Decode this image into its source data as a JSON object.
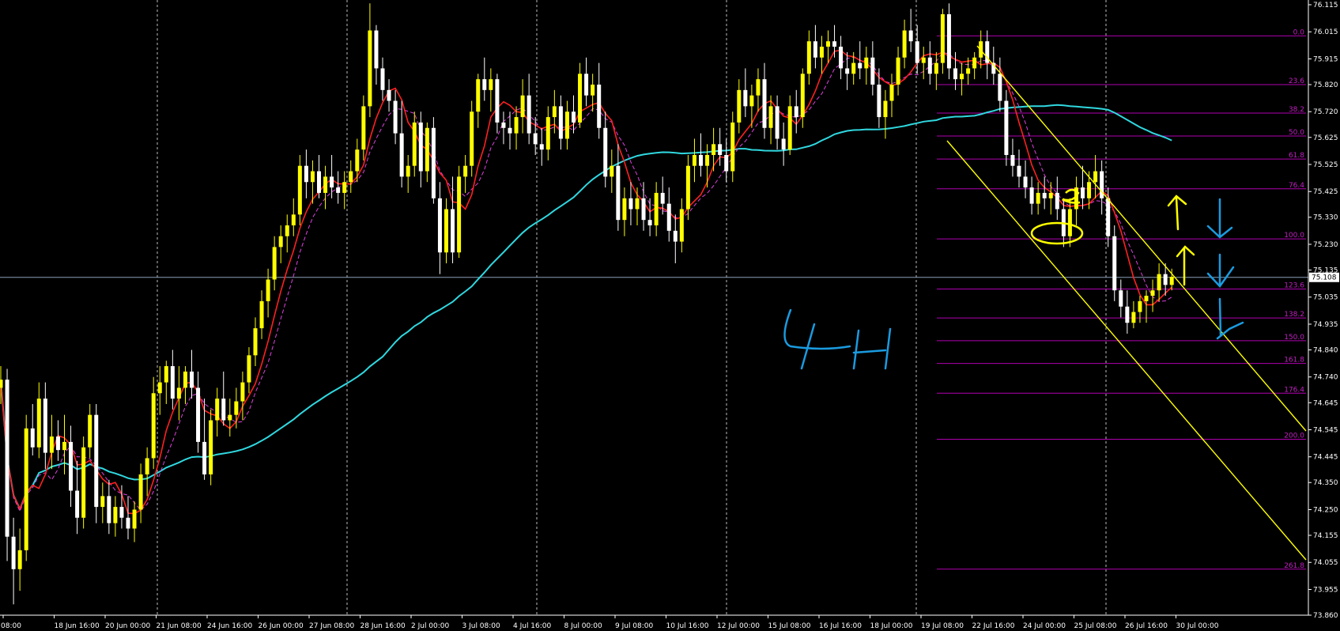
{
  "chart_data": {
    "type": "candlestick",
    "timeframe_annotation": "4H",
    "ylim": [
      73.86,
      76.115
    ],
    "price_axis_labels": [
      "76.115",
      "76.015",
      "75.915",
      "75.820",
      "75.720",
      "75.625",
      "75.525",
      "75.425",
      "75.330",
      "75.230",
      "75.135",
      "75.035",
      "74.935",
      "74.840",
      "74.740",
      "74.645",
      "74.545",
      "74.445",
      "74.350",
      "74.250",
      "74.155",
      "74.055",
      "73.955",
      "73.860"
    ],
    "time_axis_labels": [
      "08:00",
      "18 Jun 16:00",
      "20 Jun 00:00",
      "21 Jun 08:00",
      "24 Jun 16:00",
      "26 Jun 00:00",
      "27 Jun 08:00",
      "28 Jun 16:00",
      "2 Jul 00:00",
      "3 Jul 08:00",
      "4 Jul 16:00",
      "8 Jul 00:00",
      "9 Jul 08:00",
      "10 Jul 16:00",
      "12 Jul 00:00",
      "15 Jul 08:00",
      "16 Jul 16:00",
      "18 Jul 00:00",
      "19 Jul 08:00",
      "22 Jul 16:00",
      "24 Jul 00:00",
      "25 Jul 08:00",
      "26 Jul 16:00",
      "30 Jul 00:00"
    ],
    "current_price": "75.108",
    "fibonacci_levels": [
      {
        "label": "0.0",
        "price": 76.0
      },
      {
        "label": "23.6",
        "price": 75.82
      },
      {
        "label": "38.2",
        "price": 75.715
      },
      {
        "label": "50.0",
        "price": 75.63
      },
      {
        "label": "61.8",
        "price": 75.545
      },
      {
        "label": "76.4",
        "price": 75.435
      },
      {
        "label": "100.0",
        "price": 75.25
      },
      {
        "label": "123.6",
        "price": 75.065
      },
      {
        "label": "138.2",
        "price": 74.958
      },
      {
        "label": "150.0",
        "price": 74.874
      },
      {
        "label": "161.8",
        "price": 74.79
      },
      {
        "label": "176.4",
        "price": 74.68
      },
      {
        "label": "200.0",
        "price": 74.51
      },
      {
        "label": "261.8",
        "price": 74.03
      }
    ],
    "candles": [
      {
        "o": 74.7,
        "h": 74.78,
        "l": 74.64,
        "c": 74.73
      },
      {
        "o": 74.73,
        "h": 74.77,
        "l": 74.06,
        "c": 74.15
      },
      {
        "o": 74.15,
        "h": 74.22,
        "l": 73.9,
        "c": 74.03
      },
      {
        "o": 74.03,
        "h": 74.18,
        "l": 73.95,
        "c": 74.1
      },
      {
        "o": 74.1,
        "h": 74.6,
        "l": 74.06,
        "c": 74.55
      },
      {
        "o": 74.55,
        "h": 74.64,
        "l": 74.45,
        "c": 74.48
      },
      {
        "o": 74.48,
        "h": 74.72,
        "l": 74.44,
        "c": 74.66
      },
      {
        "o": 74.66,
        "h": 74.72,
        "l": 74.4,
        "c": 74.46
      },
      {
        "o": 74.46,
        "h": 74.6,
        "l": 74.4,
        "c": 74.52
      },
      {
        "o": 74.52,
        "h": 74.58,
        "l": 74.43,
        "c": 74.47
      },
      {
        "o": 74.47,
        "h": 74.6,
        "l": 74.38,
        "c": 74.5
      },
      {
        "o": 74.5,
        "h": 74.56,
        "l": 74.26,
        "c": 74.32
      },
      {
        "o": 74.32,
        "h": 74.43,
        "l": 74.16,
        "c": 74.22
      },
      {
        "o": 74.22,
        "h": 74.52,
        "l": 74.18,
        "c": 74.48
      },
      {
        "o": 74.48,
        "h": 74.64,
        "l": 74.44,
        "c": 74.6
      },
      {
        "o": 74.6,
        "h": 74.64,
        "l": 74.2,
        "c": 74.26
      },
      {
        "o": 74.26,
        "h": 74.35,
        "l": 74.2,
        "c": 74.3
      },
      {
        "o": 74.3,
        "h": 74.36,
        "l": 74.16,
        "c": 74.2
      },
      {
        "o": 74.2,
        "h": 74.3,
        "l": 74.15,
        "c": 74.26
      },
      {
        "o": 74.26,
        "h": 74.34,
        "l": 74.18,
        "c": 74.22
      },
      {
        "o": 74.22,
        "h": 74.3,
        "l": 74.14,
        "c": 74.18
      },
      {
        "o": 74.18,
        "h": 74.28,
        "l": 74.13,
        "c": 74.25
      },
      {
        "o": 74.25,
        "h": 74.42,
        "l": 74.2,
        "c": 74.38
      },
      {
        "o": 74.38,
        "h": 74.48,
        "l": 74.3,
        "c": 74.44
      },
      {
        "o": 74.44,
        "h": 74.74,
        "l": 74.4,
        "c": 74.68
      },
      {
        "o": 74.68,
        "h": 74.78,
        "l": 74.6,
        "c": 74.72
      },
      {
        "o": 74.72,
        "h": 74.8,
        "l": 74.64,
        "c": 74.78
      },
      {
        "o": 74.78,
        "h": 74.84,
        "l": 74.62,
        "c": 74.66
      },
      {
        "o": 74.66,
        "h": 74.78,
        "l": 74.58,
        "c": 74.7
      },
      {
        "o": 74.7,
        "h": 74.78,
        "l": 74.64,
        "c": 74.76
      },
      {
        "o": 74.76,
        "h": 74.84,
        "l": 74.66,
        "c": 74.7
      },
      {
        "o": 74.7,
        "h": 74.76,
        "l": 74.46,
        "c": 74.5
      },
      {
        "o": 74.5,
        "h": 74.66,
        "l": 74.36,
        "c": 74.38
      },
      {
        "o": 74.38,
        "h": 74.62,
        "l": 74.34,
        "c": 74.58
      },
      {
        "o": 74.58,
        "h": 74.7,
        "l": 74.52,
        "c": 74.66
      },
      {
        "o": 74.66,
        "h": 74.76,
        "l": 74.56,
        "c": 74.58
      },
      {
        "o": 74.58,
        "h": 74.66,
        "l": 74.52,
        "c": 74.6
      },
      {
        "o": 74.6,
        "h": 74.7,
        "l": 74.55,
        "c": 74.65
      },
      {
        "o": 74.65,
        "h": 74.76,
        "l": 74.58,
        "c": 74.72
      },
      {
        "o": 74.72,
        "h": 74.85,
        "l": 74.68,
        "c": 74.82
      },
      {
        "o": 74.82,
        "h": 74.96,
        "l": 74.78,
        "c": 74.92
      },
      {
        "o": 74.92,
        "h": 75.06,
        "l": 74.88,
        "c": 75.02
      },
      {
        "o": 75.02,
        "h": 75.14,
        "l": 74.96,
        "c": 75.1
      },
      {
        "o": 75.1,
        "h": 75.26,
        "l": 75.06,
        "c": 75.22
      },
      {
        "o": 75.22,
        "h": 75.3,
        "l": 75.16,
        "c": 75.26
      },
      {
        "o": 75.26,
        "h": 75.34,
        "l": 75.2,
        "c": 75.3
      },
      {
        "o": 75.3,
        "h": 75.4,
        "l": 75.26,
        "c": 75.34
      },
      {
        "o": 75.34,
        "h": 75.56,
        "l": 75.3,
        "c": 75.52
      },
      {
        "o": 75.52,
        "h": 75.58,
        "l": 75.4,
        "c": 75.46
      },
      {
        "o": 75.46,
        "h": 75.54,
        "l": 75.38,
        "c": 75.5
      },
      {
        "o": 75.5,
        "h": 75.56,
        "l": 75.4,
        "c": 75.42
      },
      {
        "o": 75.42,
        "h": 75.52,
        "l": 75.36,
        "c": 75.48
      },
      {
        "o": 75.48,
        "h": 75.56,
        "l": 75.4,
        "c": 75.44
      },
      {
        "o": 75.44,
        "h": 75.5,
        "l": 75.38,
        "c": 75.42
      },
      {
        "o": 75.42,
        "h": 75.5,
        "l": 75.36,
        "c": 75.46
      },
      {
        "o": 75.46,
        "h": 75.54,
        "l": 75.42,
        "c": 75.5
      },
      {
        "o": 75.5,
        "h": 75.62,
        "l": 75.46,
        "c": 75.58
      },
      {
        "o": 75.58,
        "h": 75.78,
        "l": 75.54,
        "c": 75.74
      },
      {
        "o": 75.74,
        "h": 76.12,
        "l": 75.7,
        "c": 76.02
      },
      {
        "o": 76.02,
        "h": 76.04,
        "l": 75.82,
        "c": 75.88
      },
      {
        "o": 75.88,
        "h": 75.92,
        "l": 75.76,
        "c": 75.8
      },
      {
        "o": 75.8,
        "h": 75.84,
        "l": 75.72,
        "c": 75.76
      },
      {
        "o": 75.76,
        "h": 75.8,
        "l": 75.6,
        "c": 75.64
      },
      {
        "o": 75.64,
        "h": 75.76,
        "l": 75.44,
        "c": 75.48
      },
      {
        "o": 75.48,
        "h": 75.56,
        "l": 75.42,
        "c": 75.52
      },
      {
        "o": 75.52,
        "h": 75.72,
        "l": 75.48,
        "c": 75.68
      },
      {
        "o": 75.68,
        "h": 75.72,
        "l": 75.44,
        "c": 75.5
      },
      {
        "o": 75.5,
        "h": 75.68,
        "l": 75.46,
        "c": 75.66
      },
      {
        "o": 75.66,
        "h": 75.7,
        "l": 75.38,
        "c": 75.4
      },
      {
        "o": 75.4,
        "h": 75.46,
        "l": 75.12,
        "c": 75.2
      },
      {
        "o": 75.2,
        "h": 75.4,
        "l": 75.16,
        "c": 75.36
      },
      {
        "o": 75.36,
        "h": 75.48,
        "l": 75.16,
        "c": 75.2
      },
      {
        "o": 75.2,
        "h": 75.52,
        "l": 75.18,
        "c": 75.48
      },
      {
        "o": 75.48,
        "h": 75.56,
        "l": 75.42,
        "c": 75.52
      },
      {
        "o": 75.52,
        "h": 75.76,
        "l": 75.48,
        "c": 75.72
      },
      {
        "o": 75.72,
        "h": 75.86,
        "l": 75.66,
        "c": 75.84
      },
      {
        "o": 75.84,
        "h": 75.92,
        "l": 75.76,
        "c": 75.8
      },
      {
        "o": 75.8,
        "h": 75.88,
        "l": 75.72,
        "c": 75.84
      },
      {
        "o": 75.84,
        "h": 75.86,
        "l": 75.64,
        "c": 75.68
      },
      {
        "o": 75.68,
        "h": 75.72,
        "l": 75.6,
        "c": 75.66
      },
      {
        "o": 75.66,
        "h": 75.72,
        "l": 75.58,
        "c": 75.64
      },
      {
        "o": 75.64,
        "h": 75.74,
        "l": 75.58,
        "c": 75.7
      },
      {
        "o": 75.7,
        "h": 75.84,
        "l": 75.64,
        "c": 75.78
      },
      {
        "o": 75.78,
        "h": 75.86,
        "l": 75.6,
        "c": 75.64
      },
      {
        "o": 75.64,
        "h": 75.7,
        "l": 75.56,
        "c": 75.6
      },
      {
        "o": 75.6,
        "h": 75.66,
        "l": 75.52,
        "c": 75.58
      },
      {
        "o": 75.58,
        "h": 75.74,
        "l": 75.54,
        "c": 75.7
      },
      {
        "o": 75.7,
        "h": 75.8,
        "l": 75.64,
        "c": 75.74
      },
      {
        "o": 75.74,
        "h": 75.78,
        "l": 75.58,
        "c": 75.62
      },
      {
        "o": 75.62,
        "h": 75.76,
        "l": 75.58,
        "c": 75.72
      },
      {
        "o": 75.72,
        "h": 75.78,
        "l": 75.64,
        "c": 75.68
      },
      {
        "o": 75.68,
        "h": 75.9,
        "l": 75.66,
        "c": 75.86
      },
      {
        "o": 75.86,
        "h": 75.92,
        "l": 75.74,
        "c": 75.78
      },
      {
        "o": 75.78,
        "h": 75.86,
        "l": 75.72,
        "c": 75.82
      },
      {
        "o": 75.82,
        "h": 75.9,
        "l": 75.62,
        "c": 75.66
      },
      {
        "o": 75.66,
        "h": 75.72,
        "l": 75.44,
        "c": 75.48
      },
      {
        "o": 75.48,
        "h": 75.58,
        "l": 75.42,
        "c": 75.52
      },
      {
        "o": 75.52,
        "h": 75.6,
        "l": 75.28,
        "c": 75.32
      },
      {
        "o": 75.32,
        "h": 75.44,
        "l": 75.26,
        "c": 75.4
      },
      {
        "o": 75.4,
        "h": 75.46,
        "l": 75.3,
        "c": 75.36
      },
      {
        "o": 75.36,
        "h": 75.44,
        "l": 75.3,
        "c": 75.4
      },
      {
        "o": 75.4,
        "h": 75.46,
        "l": 75.28,
        "c": 75.32
      },
      {
        "o": 75.32,
        "h": 75.4,
        "l": 75.26,
        "c": 75.3
      },
      {
        "o": 75.3,
        "h": 75.46,
        "l": 75.26,
        "c": 75.42
      },
      {
        "o": 75.42,
        "h": 75.48,
        "l": 75.34,
        "c": 75.38
      },
      {
        "o": 75.38,
        "h": 75.44,
        "l": 75.24,
        "c": 75.28
      },
      {
        "o": 75.28,
        "h": 75.34,
        "l": 75.16,
        "c": 75.24
      },
      {
        "o": 75.24,
        "h": 75.4,
        "l": 75.2,
        "c": 75.36
      },
      {
        "o": 75.36,
        "h": 75.56,
        "l": 75.32,
        "c": 75.52
      },
      {
        "o": 75.52,
        "h": 75.62,
        "l": 75.46,
        "c": 75.56
      },
      {
        "o": 75.56,
        "h": 75.64,
        "l": 75.48,
        "c": 75.52
      },
      {
        "o": 75.52,
        "h": 75.6,
        "l": 75.44,
        "c": 75.56
      },
      {
        "o": 75.56,
        "h": 75.66,
        "l": 75.5,
        "c": 75.6
      },
      {
        "o": 75.6,
        "h": 75.66,
        "l": 75.52,
        "c": 75.56
      },
      {
        "o": 75.56,
        "h": 75.62,
        "l": 75.46,
        "c": 75.5
      },
      {
        "o": 75.5,
        "h": 75.72,
        "l": 75.46,
        "c": 75.68
      },
      {
        "o": 75.68,
        "h": 75.84,
        "l": 75.64,
        "c": 75.8
      },
      {
        "o": 75.8,
        "h": 75.88,
        "l": 75.7,
        "c": 75.74
      },
      {
        "o": 75.74,
        "h": 75.82,
        "l": 75.66,
        "c": 75.78
      },
      {
        "o": 75.78,
        "h": 75.88,
        "l": 75.72,
        "c": 75.84
      },
      {
        "o": 75.84,
        "h": 75.9,
        "l": 75.62,
        "c": 75.66
      },
      {
        "o": 75.66,
        "h": 75.78,
        "l": 75.6,
        "c": 75.74
      },
      {
        "o": 75.74,
        "h": 75.78,
        "l": 75.58,
        "c": 75.62
      },
      {
        "o": 75.62,
        "h": 75.68,
        "l": 75.52,
        "c": 75.58
      },
      {
        "o": 75.58,
        "h": 75.78,
        "l": 75.56,
        "c": 75.74
      },
      {
        "o": 75.74,
        "h": 75.8,
        "l": 75.64,
        "c": 75.7
      },
      {
        "o": 75.7,
        "h": 75.88,
        "l": 75.66,
        "c": 75.86
      },
      {
        "o": 75.86,
        "h": 76.02,
        "l": 75.82,
        "c": 75.98
      },
      {
        "o": 75.98,
        "h": 76.04,
        "l": 75.88,
        "c": 75.92
      },
      {
        "o": 75.92,
        "h": 76.0,
        "l": 75.86,
        "c": 75.96
      },
      {
        "o": 75.96,
        "h": 76.02,
        "l": 75.9,
        "c": 75.98
      },
      {
        "o": 75.98,
        "h": 76.04,
        "l": 75.92,
        "c": 75.96
      },
      {
        "o": 75.96,
        "h": 76.0,
        "l": 75.84,
        "c": 75.88
      },
      {
        "o": 75.88,
        "h": 75.94,
        "l": 75.8,
        "c": 75.86
      },
      {
        "o": 75.86,
        "h": 75.94,
        "l": 75.82,
        "c": 75.9
      },
      {
        "o": 75.9,
        "h": 75.98,
        "l": 75.84,
        "c": 75.88
      },
      {
        "o": 75.88,
        "h": 75.96,
        "l": 75.82,
        "c": 75.92
      },
      {
        "o": 75.92,
        "h": 75.98,
        "l": 75.78,
        "c": 75.82
      },
      {
        "o": 75.82,
        "h": 75.88,
        "l": 75.66,
        "c": 75.7
      },
      {
        "o": 75.7,
        "h": 75.8,
        "l": 75.62,
        "c": 75.76
      },
      {
        "o": 75.76,
        "h": 75.86,
        "l": 75.7,
        "c": 75.82
      },
      {
        "o": 75.82,
        "h": 75.96,
        "l": 75.78,
        "c": 75.92
      },
      {
        "o": 75.92,
        "h": 76.06,
        "l": 75.88,
        "c": 76.02
      },
      {
        "o": 76.02,
        "h": 76.1,
        "l": 75.94,
        "c": 75.98
      },
      {
        "o": 75.98,
        "h": 76.04,
        "l": 75.86,
        "c": 75.9
      },
      {
        "o": 75.9,
        "h": 75.96,
        "l": 75.84,
        "c": 75.92
      },
      {
        "o": 75.92,
        "h": 75.98,
        "l": 75.82,
        "c": 75.86
      },
      {
        "o": 75.86,
        "h": 75.94,
        "l": 75.8,
        "c": 75.9
      },
      {
        "o": 75.9,
        "h": 76.1,
        "l": 75.86,
        "c": 76.08
      },
      {
        "o": 76.08,
        "h": 76.12,
        "l": 75.84,
        "c": 75.88
      },
      {
        "o": 75.88,
        "h": 75.94,
        "l": 75.8,
        "c": 75.84
      },
      {
        "o": 75.84,
        "h": 75.9,
        "l": 75.78,
        "c": 75.86
      },
      {
        "o": 75.86,
        "h": 75.92,
        "l": 75.82,
        "c": 75.88
      },
      {
        "o": 75.88,
        "h": 75.94,
        "l": 75.84,
        "c": 75.92
      },
      {
        "o": 75.92,
        "h": 76.02,
        "l": 75.88,
        "c": 75.98
      },
      {
        "o": 75.98,
        "h": 76.02,
        "l": 75.84,
        "c": 75.9
      },
      {
        "o": 75.9,
        "h": 75.96,
        "l": 75.82,
        "c": 75.86
      },
      {
        "o": 75.86,
        "h": 75.92,
        "l": 75.72,
        "c": 75.76
      },
      {
        "o": 75.76,
        "h": 75.8,
        "l": 75.52,
        "c": 75.56
      },
      {
        "o": 75.56,
        "h": 75.62,
        "l": 75.48,
        "c": 75.52
      },
      {
        "o": 75.52,
        "h": 75.58,
        "l": 75.44,
        "c": 75.48
      },
      {
        "o": 75.48,
        "h": 75.54,
        "l": 75.4,
        "c": 75.44
      },
      {
        "o": 75.44,
        "h": 75.48,
        "l": 75.34,
        "c": 75.38
      },
      {
        "o": 75.38,
        "h": 75.46,
        "l": 75.34,
        "c": 75.42
      },
      {
        "o": 75.42,
        "h": 75.48,
        "l": 75.36,
        "c": 75.4
      },
      {
        "o": 75.4,
        "h": 75.46,
        "l": 75.34,
        "c": 75.42
      },
      {
        "o": 75.42,
        "h": 75.48,
        "l": 75.32,
        "c": 75.36
      },
      {
        "o": 75.36,
        "h": 75.4,
        "l": 75.22,
        "c": 75.26
      },
      {
        "o": 75.26,
        "h": 75.4,
        "l": 75.22,
        "c": 75.36
      },
      {
        "o": 75.36,
        "h": 75.48,
        "l": 75.3,
        "c": 75.44
      },
      {
        "o": 75.44,
        "h": 75.52,
        "l": 75.36,
        "c": 75.4
      },
      {
        "o": 75.4,
        "h": 75.5,
        "l": 75.36,
        "c": 75.46
      },
      {
        "o": 75.46,
        "h": 75.56,
        "l": 75.4,
        "c": 75.5
      },
      {
        "o": 75.5,
        "h": 75.54,
        "l": 75.34,
        "c": 75.4
      },
      {
        "o": 75.4,
        "h": 75.44,
        "l": 75.22,
        "c": 75.26
      },
      {
        "o": 75.26,
        "h": 75.3,
        "l": 75.02,
        "c": 75.06
      },
      {
        "o": 75.06,
        "h": 75.1,
        "l": 74.96,
        "c": 75.0
      },
      {
        "o": 75.0,
        "h": 75.06,
        "l": 74.9,
        "c": 74.94
      },
      {
        "o": 74.94,
        "h": 75.02,
        "l": 74.92,
        "c": 74.98
      },
      {
        "o": 74.98,
        "h": 75.04,
        "l": 74.94,
        "c": 75.02
      },
      {
        "o": 75.02,
        "h": 75.06,
        "l": 74.94,
        "c": 75.04
      },
      {
        "o": 75.04,
        "h": 75.1,
        "l": 74.98,
        "c": 75.06
      },
      {
        "o": 75.06,
        "h": 75.16,
        "l": 75.02,
        "c": 75.12
      },
      {
        "o": 75.12,
        "h": 75.16,
        "l": 75.04,
        "c": 75.08
      },
      {
        "o": 75.08,
        "h": 75.14,
        "l": 75.06,
        "c": 75.11
      }
    ]
  }
}
